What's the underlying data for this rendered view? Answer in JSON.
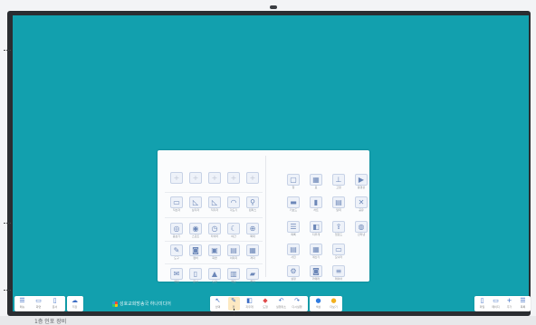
{
  "device": {
    "chin_left": "1층 인포 장비",
    "chin_right": ""
  },
  "panel": {
    "blank_tools": [
      "",
      "",
      "",
      "",
      ""
    ],
    "left_rows": [
      [
        {
          "icon": "ruler-icon",
          "label": "직선자"
        },
        {
          "icon": "triangle-ruler-icon",
          "label": "삼각자"
        },
        {
          "icon": "triangle-ruler-icon",
          "label": "직각자"
        },
        {
          "icon": "protractor-icon",
          "label": "각도기"
        },
        {
          "icon": "compass-icon",
          "label": "컴퍼스"
        }
      ],
      [
        {
          "icon": "magnifier-icon",
          "label": "돋보기"
        },
        {
          "icon": "spotlight-icon",
          "label": "스포트"
        },
        {
          "icon": "timer-icon",
          "label": "타이머"
        },
        {
          "icon": "moon-icon",
          "label": "야간"
        },
        {
          "icon": "zoom-icon",
          "label": "확대"
        }
      ],
      [
        {
          "icon": "tools-icon",
          "label": "도구"
        },
        {
          "icon": "camera-icon",
          "label": "캡처"
        },
        {
          "icon": "screen-icon",
          "label": "화면"
        },
        {
          "icon": "image-icon",
          "label": "이미지"
        },
        {
          "icon": "grid-icon",
          "label": "격자"
        }
      ],
      [
        {
          "icon": "mail-icon",
          "label": "메일"
        },
        {
          "icon": "document-icon",
          "label": "문서"
        },
        {
          "icon": "stamp-icon",
          "label": "도장"
        },
        {
          "icon": "note-icon",
          "label": "메모"
        },
        {
          "icon": "folder-icon",
          "label": "폴더"
        }
      ]
    ],
    "right_rows": [
      [
        {
          "icon": "window-icon",
          "label": "창"
        },
        {
          "icon": "table-icon",
          "label": "표"
        },
        {
          "icon": "pin-icon",
          "label": "고정"
        },
        {
          "icon": "video-icon",
          "label": "동영상"
        }
      ],
      [
        {
          "icon": "keyboard-icon",
          "label": "키보드"
        },
        {
          "icon": "chart-icon",
          "label": "차트"
        },
        {
          "icon": "calendar-icon",
          "label": "달력"
        },
        {
          "icon": "share-icon",
          "label": "공유"
        }
      ],
      [
        {
          "icon": "list-icon",
          "label": "목록"
        },
        {
          "icon": "eraser-icon",
          "label": "지우개"
        },
        {
          "icon": "upload-icon",
          "label": "업로드"
        },
        {
          "icon": "globe-icon",
          "label": "인터넷"
        }
      ],
      [
        {
          "icon": "image-icon",
          "label": "사진"
        },
        {
          "icon": "calculator-icon",
          "label": "계산기"
        },
        {
          "icon": "monitor-icon",
          "label": "모니터"
        }
      ],
      [
        {
          "icon": "settings-icon",
          "label": "설정"
        },
        {
          "icon": "camera-icon",
          "label": "카메라"
        },
        {
          "icon": "layers-icon",
          "label": "레이어"
        }
      ]
    ]
  },
  "toolbar": {
    "left": [
      {
        "icon": "menu-icon",
        "label": "메뉴"
      },
      {
        "icon": "monitor-icon",
        "label": "화면"
      },
      {
        "icon": "document-icon",
        "label": "문서"
      },
      {
        "icon": "cloud-icon",
        "label": "저장"
      }
    ],
    "logo_text": "성호교회방송국 하나미디어",
    "center": [
      {
        "icon": "pointer-icon",
        "label": "선택"
      },
      {
        "icon": "pen-icon",
        "label": "펜",
        "active": true
      },
      {
        "icon": "eraser-icon",
        "label": "지우개"
      },
      {
        "icon": "shape-icon",
        "label": "도형"
      },
      {
        "icon": "undo-icon",
        "label": "실행취소"
      },
      {
        "icon": "redo-icon",
        "label": "다시실행"
      },
      {
        "icon": "color-icon",
        "label": "색상"
      },
      {
        "icon": "more-icon",
        "label": "더보기"
      }
    ],
    "right": [
      {
        "icon": "file-icon",
        "label": "파일"
      },
      {
        "icon": "page-icon",
        "label": "페이지"
      },
      {
        "icon": "add-page-icon",
        "label": "추가"
      },
      {
        "icon": "list-icon",
        "label": "목록"
      }
    ]
  },
  "colors": {
    "screen": "#12a0ae",
    "bezel": "#2a2d31",
    "accent": "#3b6cc4",
    "active_tool": "#fde9c2"
  }
}
